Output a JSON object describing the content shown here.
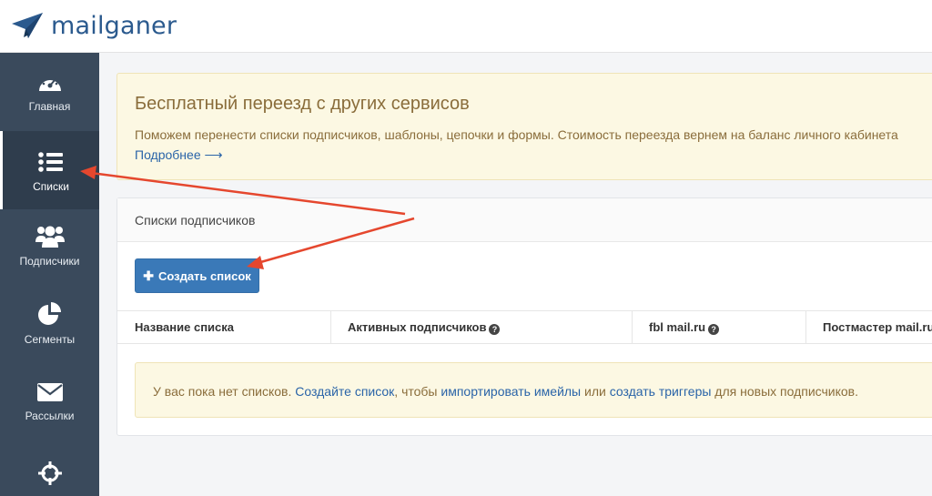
{
  "brand": {
    "name": "mailganer"
  },
  "sidebar": {
    "items": [
      {
        "label": "Главная",
        "icon": "dashboard-icon"
      },
      {
        "label": "Списки",
        "icon": "list-icon",
        "active": true
      },
      {
        "label": "Подписчики",
        "icon": "users-icon"
      },
      {
        "label": "Сегменты",
        "icon": "pie-chart-icon"
      },
      {
        "label": "Рассылки",
        "icon": "envelope-icon"
      },
      {
        "label": "",
        "icon": "crosshair-icon"
      }
    ]
  },
  "promo": {
    "title": "Бесплатный переезд с других сервисов",
    "text": "Поможем перенести списки подписчиков, шаблоны, цепочки и формы. Стоимость переезда вернем на баланс личного кабинета",
    "link": "Подробнее ⟶"
  },
  "panel": {
    "title": "Списки подписчиков",
    "create_button": "Создать список",
    "columns": [
      "Название списка",
      "Активных подписчиков",
      "fbl mail.ru",
      "Постмастер mail.ru"
    ],
    "empty": {
      "part1": "У вас пока нет списков. ",
      "link1": "Создайте список",
      "part2": ", чтобы ",
      "link2": "импортировать имейлы",
      "part3": " или ",
      "link3": "создать триггеры",
      "part4": " для новых подписчиков."
    }
  },
  "colors": {
    "sidebar": "#3a4a5c",
    "accent": "#3a79b8",
    "warning_bg": "#fcf8e3",
    "arrow": "#e5472e"
  }
}
